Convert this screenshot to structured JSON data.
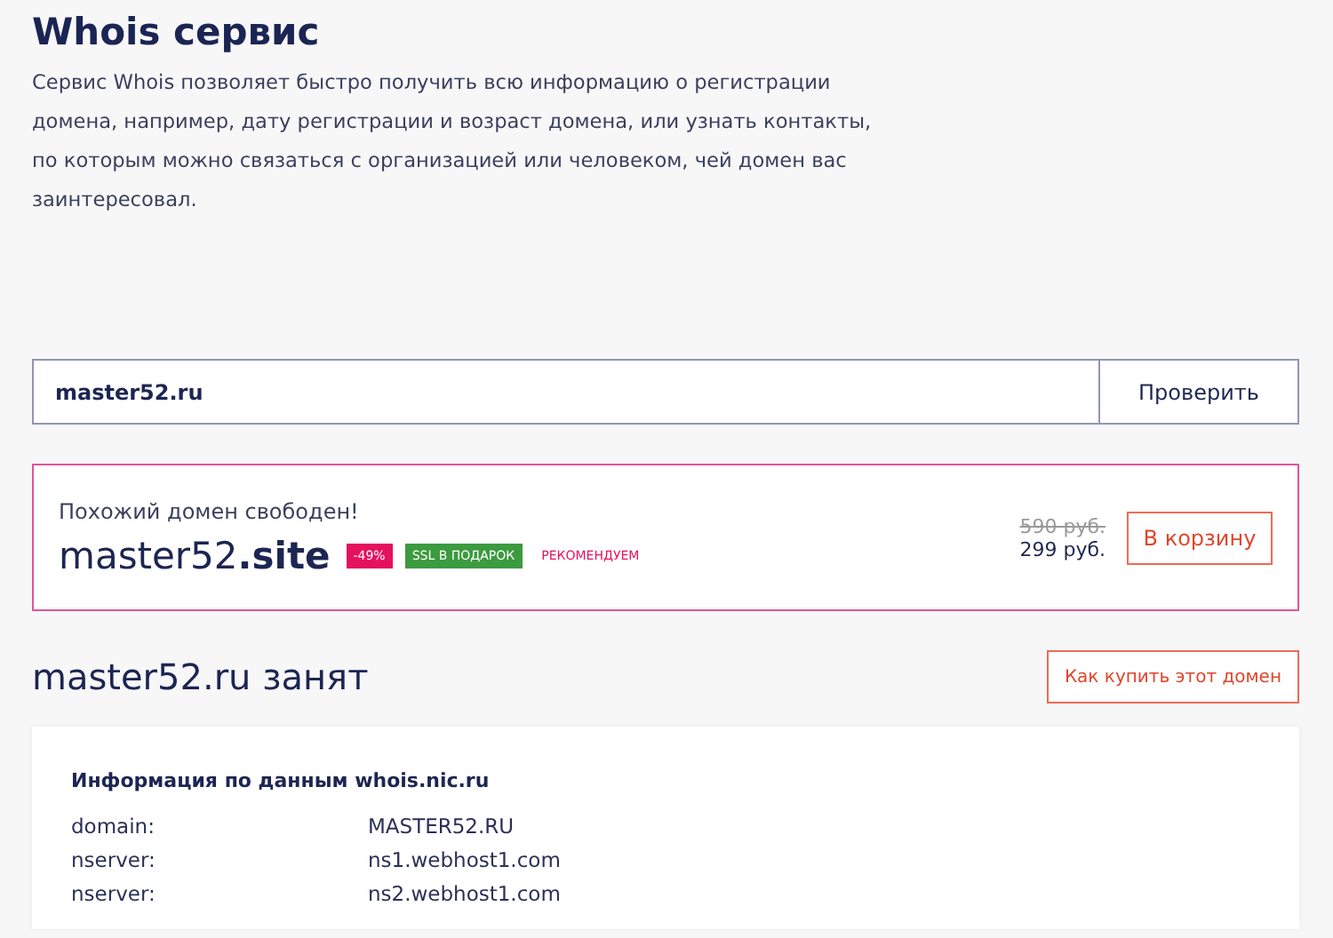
{
  "title": "Whois сервис",
  "description": "Сервис Whois позволяет быстро получить всю информацию о регистрации домена, например, дату регистрации и возраст домена, или узнать контакты, по которым можно связаться с организацией или человеком, чей домен вас заинтересовал.",
  "search": {
    "value": "master52.ru",
    "button": "Проверить"
  },
  "suggestion": {
    "heading": "Похожий домен свободен!",
    "domain_name": "master52",
    "domain_zone": ".site",
    "badges": [
      {
        "kind": "discount",
        "label": "-49%"
      },
      {
        "kind": "gift",
        "label": "SSL В ПОДАРОК"
      },
      {
        "kind": "note",
        "label": "РЕКОМЕНДУЕМ"
      }
    ],
    "old_price": "590 руб.",
    "price": "299 руб.",
    "button": "В корзину"
  },
  "result": {
    "heading": "master52.ru занят",
    "button": "Как купить этот домен"
  },
  "whois": {
    "title": "Информация по данным whois.nic.ru",
    "rows": [
      {
        "key": "domain:",
        "value": "MASTER52.RU"
      },
      {
        "key": "nserver:",
        "value": "ns1.webhost1.com"
      },
      {
        "key": "nserver:",
        "value": "ns2.webhost1.com"
      }
    ]
  }
}
